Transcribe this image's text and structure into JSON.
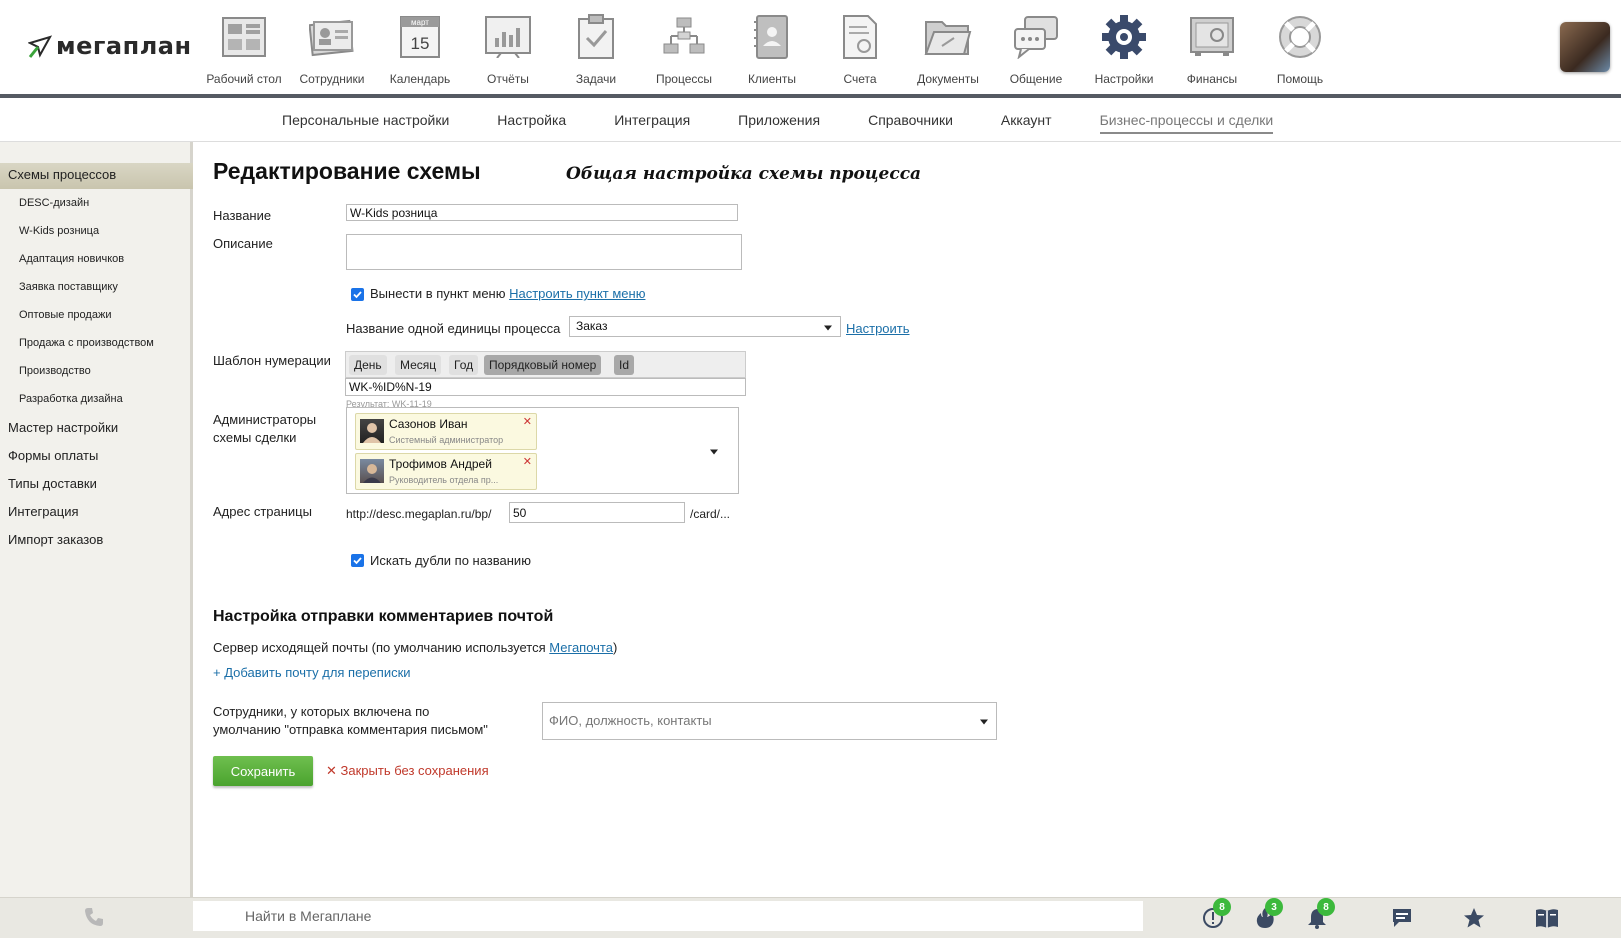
{
  "app": {
    "logo_text": "мегаплан"
  },
  "nav": [
    {
      "label": "Рабочий стол",
      "icon": "desktop-icon"
    },
    {
      "label": "Сотрудники",
      "icon": "employees-icon"
    },
    {
      "label": "Календарь",
      "icon": "calendar-icon",
      "calendar_month": "март",
      "calendar_day": "15"
    },
    {
      "label": "Отчёты",
      "icon": "reports-icon"
    },
    {
      "label": "Задачи",
      "icon": "tasks-icon"
    },
    {
      "label": "Процессы",
      "icon": "processes-icon"
    },
    {
      "label": "Клиенты",
      "icon": "clients-icon"
    },
    {
      "label": "Счета",
      "icon": "invoices-icon"
    },
    {
      "label": "Документы",
      "icon": "documents-icon"
    },
    {
      "label": "Общение",
      "icon": "chat-icon"
    },
    {
      "label": "Настройки",
      "icon": "settings-icon",
      "active": true
    },
    {
      "label": "Финансы",
      "icon": "finance-icon"
    },
    {
      "label": "Помощь",
      "icon": "help-icon"
    }
  ],
  "subnav": [
    "Персональные настройки",
    "Настройка",
    "Интеграция",
    "Приложения",
    "Справочники",
    "Аккаунт",
    "Бизнес-процессы и сделки"
  ],
  "sidebar": {
    "active": "Схемы процессов",
    "sub_items": [
      "DESC-дизайн",
      "W-Kids розница",
      "Адаптация новичков",
      "Заявка поставщику",
      "Оптовые продажи",
      "Продажа с производством",
      "Производство",
      "Разработка дизайна"
    ],
    "main_items": [
      "Мастер настройки",
      "Формы оплаты",
      "Типы доставки",
      "Интеграция",
      "Импорт заказов"
    ]
  },
  "form": {
    "title": "Редактирование схемы",
    "subtitle": "Общая настройка схемы процесса",
    "name_label": "Название",
    "name_value": "W-Kids розница",
    "description_label": "Описание",
    "description_value": "",
    "menu_checkbox_label": "Вынести в пункт меню",
    "menu_checkbox_checked": true,
    "menu_config_link": "Настроить пункт меню",
    "unit_label": "Название одной единицы процесса",
    "unit_value": "Заказ",
    "unit_config_link": "Настроить",
    "numbering_label": "Шаблон нумерации",
    "numbering_tokens": [
      "День",
      "Месяц",
      "Год",
      "Порядковый номер",
      "Id"
    ],
    "numbering_value": "WK-%ID%N-19",
    "numbering_result": "Результат: WK-11-19",
    "admins_label_1": "Администраторы",
    "admins_label_2": "схемы сделки",
    "admins": [
      {
        "name": "Сазонов Иван",
        "role": "Системный администратор"
      },
      {
        "name": "Трофимов Андрей",
        "role": "Руководитель отдела пр..."
      }
    ],
    "address_label": "Адрес страницы",
    "address_prefix": "http://desc.megaplan.ru/bp/",
    "address_value": "50",
    "address_suffix": "/card/...",
    "dupes_label": "Искать дубли по названию",
    "dupes_checked": true
  },
  "mail": {
    "section_title": "Настройка отправки комментариев почтой",
    "server_text": "Сервер исходящей почты (по умолчанию используется ",
    "server_link": "Мегапочта",
    "server_text_end": ")",
    "add_mail_link": "+ Добавить почту для переписки",
    "employees_label_1": "Сотрудники, у которых включена по",
    "employees_label_2": "умолчанию \"отправка комментария письмом\"",
    "employees_placeholder": "ФИО, должность, контакты"
  },
  "actions": {
    "save": "Сохранить",
    "close_x": "✕",
    "close": "Закрыть без сохранения"
  },
  "bottom": {
    "search_placeholder": "Найти в Мегаплане",
    "badges": {
      "alerts": "8",
      "hot": "3",
      "notifications": "8"
    }
  },
  "colors": {
    "accent_green": "#4aa32e",
    "link_blue": "#1b6fa8",
    "badge_green": "#3cb93c",
    "close_red": "#c0392b"
  }
}
